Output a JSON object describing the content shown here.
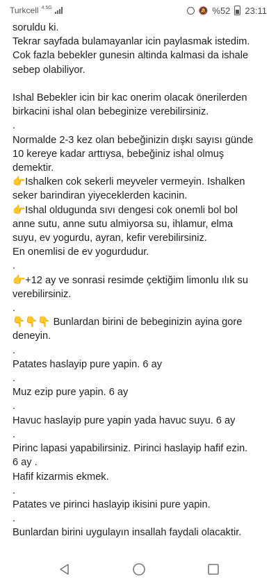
{
  "status_bar": {
    "carrier": "Turkcell",
    "network": "4.5G",
    "battery": "%52",
    "time": "23:11"
  },
  "article": {
    "lines": [
      "soruldu ki.",
      "Tekrar sayfada bulamayanlar icin paylasmak istedim.",
      "Cok fazla bebekler gunesin altinda kalmasi da ishale",
      "sebep olabiliyor.",
      "",
      "Ishal Bebekler icin bir kac onerim olacak önerilerden",
      "birkacini ishal olan bebeginize verebilirsiniz.",
      ".",
      "Normalde 2-3 kez olan bebeğinizin dışkı sayısı günde",
      "10 kereye kadar arttıysa, bebeğiniz ishal olmuş",
      "demektir.",
      "👉Ishalken cok sekerli meyveler vermeyin. Ishalken",
      "seker barindiran yiyeceklerden kacinin.",
      "👉Ishal oldugunda sıvı dengesi cok onemli bol bol",
      "anne sutu, anne sutu almiyorsa su, ihlamur, elma",
      "suyu, ev yogurdu, ayran, kefir verebilirsiniz.",
      "En onemlisi de ev yogurdudur.",
      ".",
      "👉+12 ay ve sonrasi resimde çektiğim limonlu ılık su",
      "verebilirsiniz.",
      ".",
      "👇👇👇 Bunlardan birini de bebeginizin ayina gore",
      "deneyin.",
      ".",
      "Patates haslayip pure yapin. 6 ay",
      ".",
      "Muz ezip pure yapin. 6 ay",
      ".",
      "Havuc haslayip pure yapin yada havuc suyu. 6 ay",
      ".",
      "Pirinc lapasi yapabilirsiniz. Pirinci haslayip hafif ezin.",
      "6 ay .",
      "Hafif kizarmis ekmek.",
      ".",
      "Patates ve pirinci haslayip ikisini pure yapin.",
      ".",
      "Bunlardan birini uygulayın insallah faydali olacaktir."
    ]
  },
  "nav": {
    "icons": [
      "back-icon",
      "home-icon",
      "recents-icon"
    ]
  },
  "colors": {
    "text": "#222222",
    "emoji": "#f0a318",
    "nav_icon": "#777777"
  }
}
